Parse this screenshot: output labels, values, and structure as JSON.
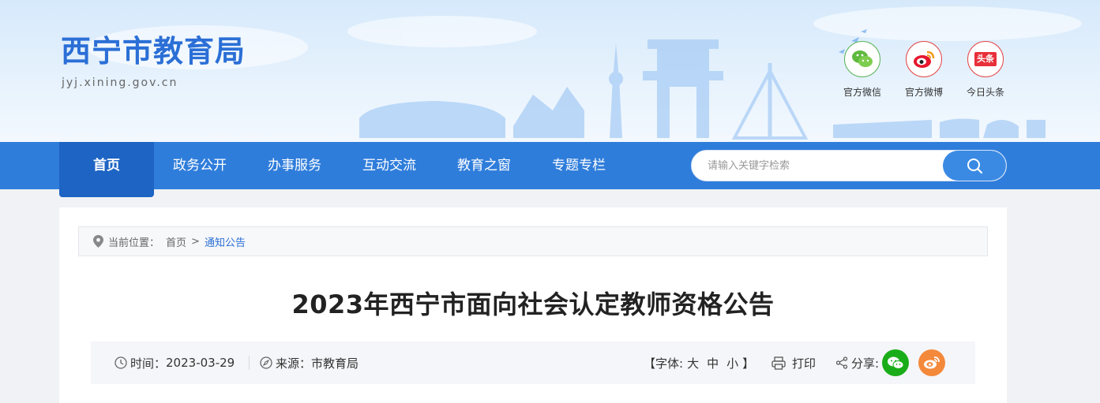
{
  "header": {
    "site_title": "西宁市教育局",
    "site_domain": "jyj.xining.gov.cn",
    "social": [
      {
        "label": "官方微信",
        "icon": "wechat-icon"
      },
      {
        "label": "官方微博",
        "icon": "weibo-icon"
      },
      {
        "label": "今日头条",
        "icon": "toutiao-icon",
        "icon_text": "头条"
      }
    ]
  },
  "nav": {
    "items": [
      {
        "label": "首页"
      },
      {
        "label": "政务公开"
      },
      {
        "label": "办事服务"
      },
      {
        "label": "互动交流"
      },
      {
        "label": "教育之窗"
      },
      {
        "label": "专题专栏"
      }
    ],
    "search_placeholder": "请输入关键字检索"
  },
  "breadcrumb": {
    "prefix": "当前位置：",
    "home": "首页",
    "separator": ">",
    "current": "通知公告"
  },
  "article": {
    "title": "2023年西宁市面向社会认定教师资格公告",
    "time_label": "时间：",
    "time_value": "2023-03-29",
    "source_label": "来源：",
    "source_value": "市教育局",
    "font_label_open": "【字体:",
    "font_large": "大",
    "font_medium": "中",
    "font_small": "小",
    "font_label_close": "】",
    "print_label": "打印",
    "share_label": "分享:"
  },
  "colors": {
    "brand_blue": "#2b6fd6",
    "nav_blue": "#2f7ddb",
    "nav_active": "#1d64c4",
    "wechat_green": "#1aad19",
    "weibo_orange": "#f4893b"
  }
}
